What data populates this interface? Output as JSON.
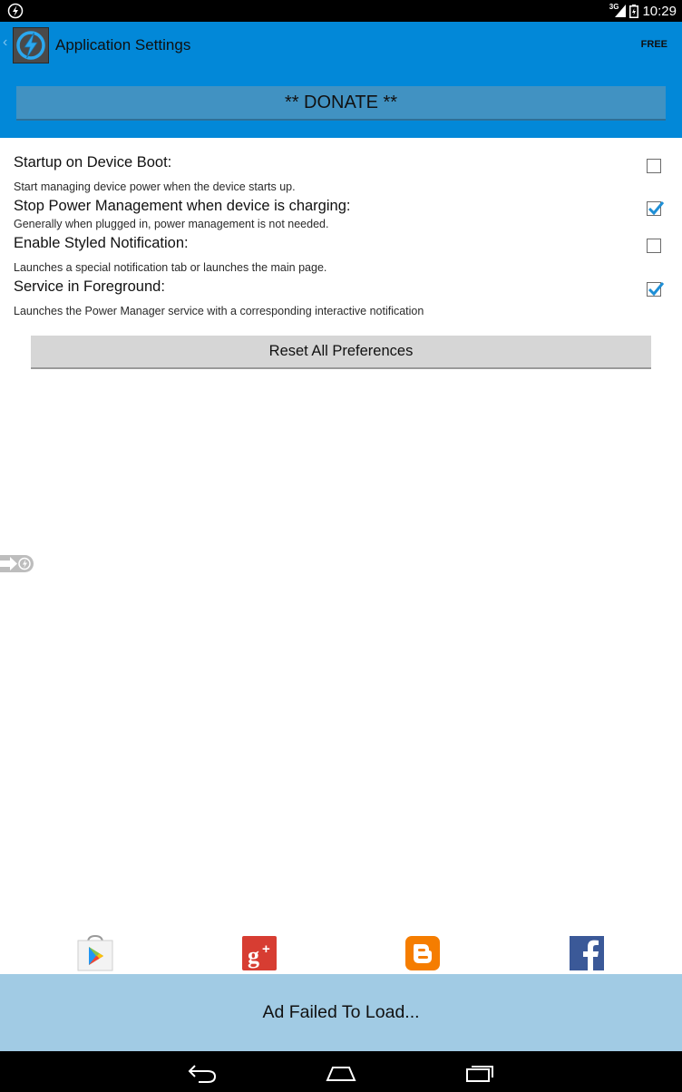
{
  "status_bar": {
    "network": "3G",
    "time": "10:29"
  },
  "action_bar": {
    "title": "Application Settings",
    "badge": "FREE"
  },
  "donate_label": "** DONATE **",
  "preferences": [
    {
      "title": "Startup on Device Boot:",
      "summary": "Start managing device power when the device starts up.",
      "checked": false
    },
    {
      "title": "Stop Power Management when device is charging:",
      "summary": "Generally when plugged in, power management is not needed.",
      "checked": true
    },
    {
      "title": "Enable Styled Notification:",
      "summary": "Launches a special notification tab or launches the main page.",
      "checked": false
    },
    {
      "title": "Service in Foreground:",
      "summary": "Launches the Power Manager service with a corresponding interactive notification",
      "checked": true
    }
  ],
  "reset_label": "Reset All Preferences",
  "social_links": [
    "google-play",
    "google-plus",
    "blogger",
    "facebook"
  ],
  "ad_text": "Ad Failed To Load...",
  "colors": {
    "action_bar": "#0288d8",
    "donate_button": "#4192c2",
    "check_accent": "#1f8fd6",
    "ad_banner": "#a1cbe4"
  }
}
